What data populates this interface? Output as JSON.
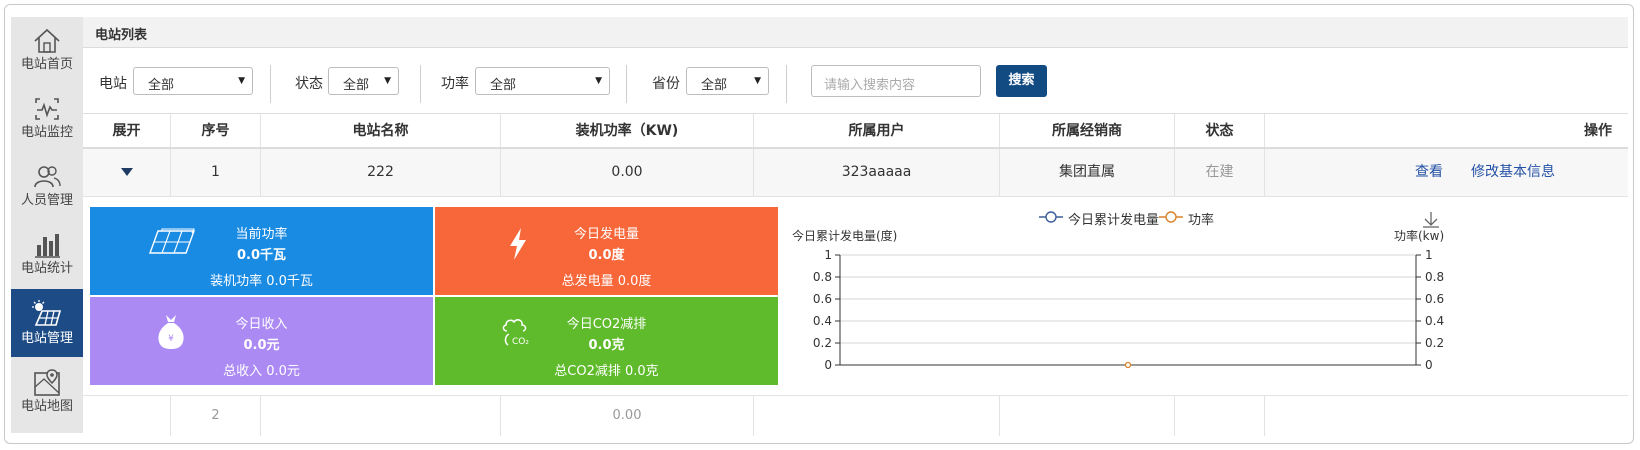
{
  "sidebar": {
    "items": [
      {
        "label": "电站首页",
        "icon": "home-icon"
      },
      {
        "label": "电站监控",
        "icon": "monitor-icon"
      },
      {
        "label": "人员管理",
        "icon": "users-icon"
      },
      {
        "label": "电站统计",
        "icon": "bar-chart-icon"
      },
      {
        "label": "电站管理",
        "icon": "solar-panel-icon"
      },
      {
        "label": "电站地图",
        "icon": "map-icon"
      }
    ],
    "active_index": 4
  },
  "page_title": "电站列表",
  "filters": {
    "station_label": "电站",
    "station_value": "全部",
    "status_label": "状态",
    "status_value": "全部",
    "power_label": "功率",
    "power_value": "全部",
    "province_label": "省份",
    "province_value": "全部",
    "search_placeholder": "请输入搜索内容",
    "search_button": "搜索"
  },
  "table": {
    "headers": [
      "展开",
      "序号",
      "电站名称",
      "装机功率（KW)",
      "所属用户",
      "所属经销商",
      "状态",
      "操作"
    ],
    "rows": [
      {
        "index": "1",
        "name": "222",
        "capacity": "0.00",
        "user": "323aaaaa",
        "dealer": "集团直属",
        "status": "在建",
        "action_view": "查看",
        "action_edit": "修改基本信息"
      },
      {
        "index": "2",
        "name": "",
        "capacity": "0.00",
        "user": "",
        "dealer": "",
        "status": "",
        "action_view": "",
        "action_edit": ""
      }
    ]
  },
  "tiles": {
    "power": {
      "title": "当前功率",
      "value": "0.0千瓦",
      "sub": "装机功率 0.0千瓦",
      "color": "#1a8be3"
    },
    "energy": {
      "title": "今日发电量",
      "value": "0.0度",
      "sub": "总发电量 0.0度",
      "color": "#f7673a"
    },
    "income": {
      "title": "今日收入",
      "value": "0.0元",
      "sub": "总收入 0.0元",
      "color": "#ac8af4"
    },
    "co2": {
      "title": "今日CO2减排",
      "value": "0.0克",
      "sub": "总CO2减排 0.0克",
      "color": "#5fbb2c"
    }
  },
  "chart_data": {
    "type": "line",
    "series": [
      {
        "name": "今日累计发电量",
        "color": "#3b5e9c",
        "axis": "left",
        "values": []
      },
      {
        "name": "功率",
        "color": "#d9822b",
        "axis": "right",
        "values": [
          0
        ]
      }
    ],
    "ylabel_left": "今日累计发电量(度)",
    "ylabel_right": "功率(kw)",
    "ylim_left": [
      0,
      1
    ],
    "ylim_right": [
      0,
      1
    ],
    "yticks": [
      "0",
      "0.2",
      "0.4",
      "0.6",
      "0.8",
      "1"
    ],
    "point_x_fraction": 0.5,
    "legend": "top-center",
    "grid": true
  }
}
